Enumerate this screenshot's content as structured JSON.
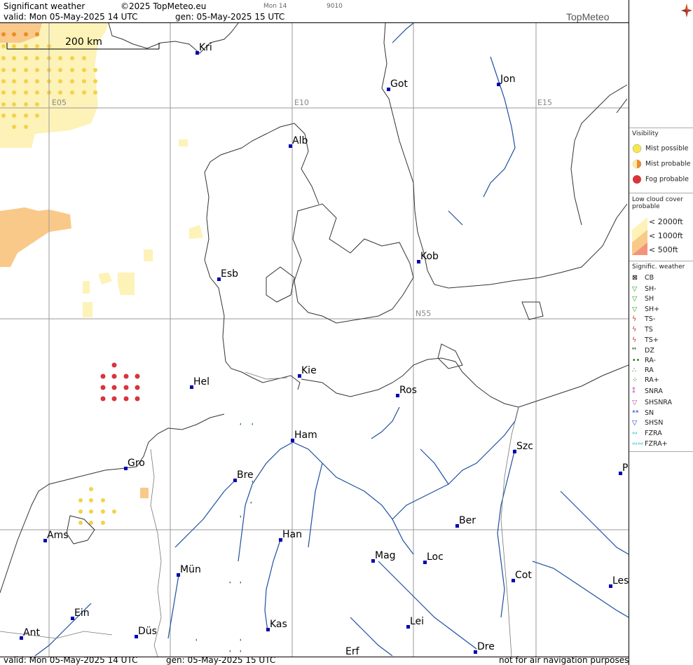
{
  "header": {
    "title": "Significant weather",
    "copyright": "©2025 TopMeteo.eu",
    "valid": "valid:  Mon  05-May-2025  14 UTC",
    "gen": "gen:  05-May-2025  15 UTC",
    "run_label": "Mon 14",
    "run_code": "9010",
    "brand": "TopMeteo"
  },
  "map": {
    "scale_label": "200 km",
    "grid_labels": [
      "E05",
      "E10",
      "E15",
      "N55"
    ],
    "cities": [
      "Kri",
      "Got",
      "Jon",
      "Alb",
      "Kob",
      "Esb",
      "Kie",
      "Hel",
      "Ros",
      "Ham",
      "Szc",
      "Gro",
      "Bre",
      "P",
      "Ber",
      "Ams",
      "Han",
      "Mag",
      "Loc",
      "Mün",
      "Cot",
      "Les",
      "Ein",
      "Kas",
      "Lei",
      "Ant",
      "Düs",
      "Dre",
      "Erf"
    ]
  },
  "legend": {
    "visibility_title": "Visibility",
    "visibility": [
      "Mist possible",
      "Mist probable",
      "Fog probable"
    ],
    "lowcloud_title": "Low cloud cover probable",
    "lowcloud": [
      "< 2000ft",
      "< 1000ft",
      "<   500ft"
    ],
    "sigwx_title": "Signific. weather",
    "sigwx": [
      "CB",
      "SH-",
      "SH",
      "SH+",
      "TS-",
      "TS",
      "TS+",
      "DZ",
      "RA-",
      "RA",
      "RA+",
      "SNRA",
      "SHSNRA",
      "SN",
      "SHSN",
      "FZRA",
      "FZRA+"
    ],
    "colors": {
      "mist_possible": "#f7e84a",
      "mist_probable": "#f08a2a",
      "fog_probable": "#d8343c",
      "cloud_2000": "#fdf2b8",
      "cloud_1000": "#f9c98a",
      "cloud_500": "#f4927a"
    }
  },
  "footer": {
    "valid": "valid:  Mon  05-May-2025  14 UTC",
    "gen": "gen:  05-May-2025  15 UTC",
    "notice": "not for air navigation purposes"
  }
}
